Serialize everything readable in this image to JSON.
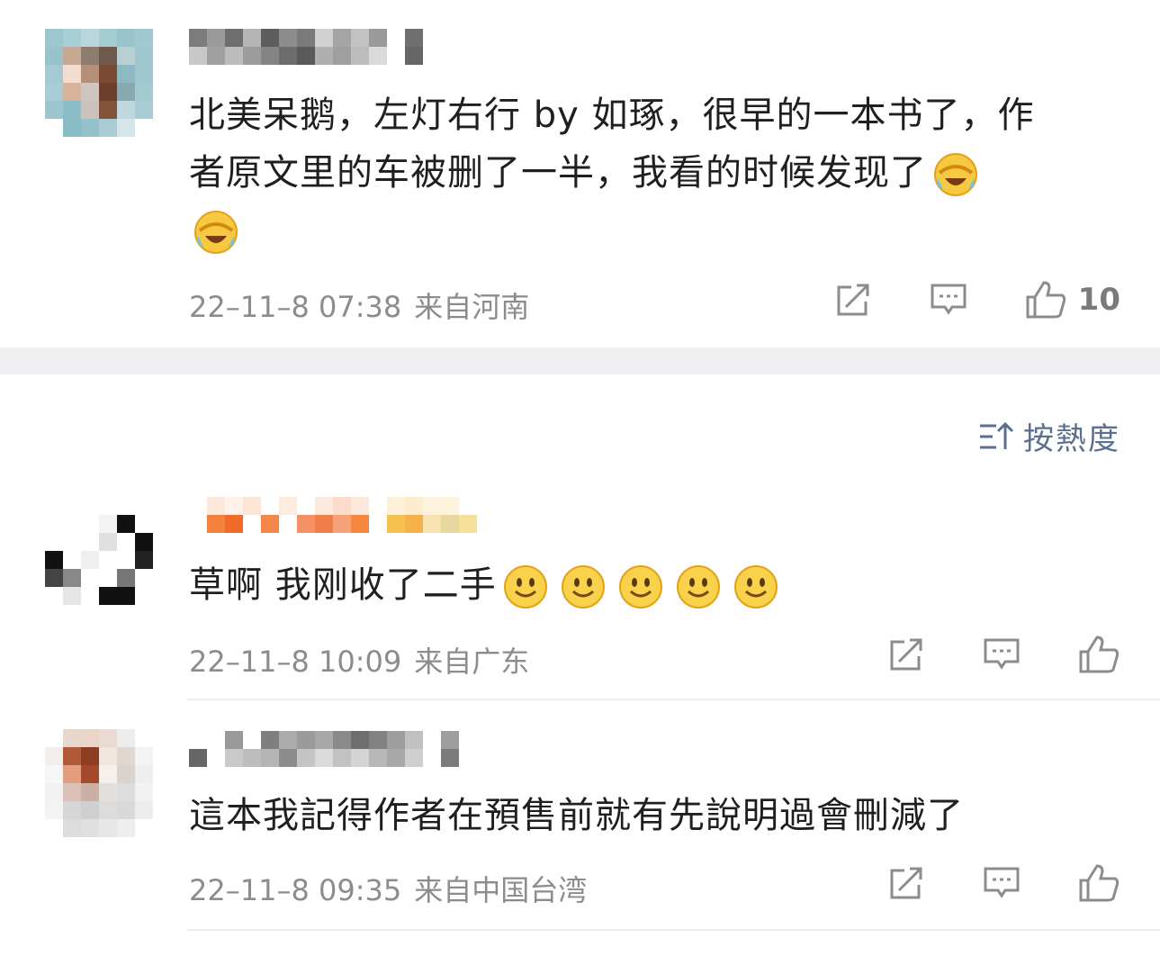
{
  "comments": [
    {
      "text_line1": "北美呆鹅，左灯右行 by 如琢，很早的一本书了，作",
      "text_line2": "者原文里的车被删了一半，我看的时候发现了",
      "time": "22–11–8 07:38",
      "region": "来自河南",
      "likes": "10",
      "emoji": "laughing-crying-emoji"
    },
    {
      "text": "草啊 我刚收了二手",
      "time": "22–11–8 10:09",
      "region": "来自广东",
      "emoji": "smile-emoji",
      "emoji_count": 5
    },
    {
      "text": "這本我記得作者在預售前就有先說明過會刪減了",
      "time": "22–11–8 09:35",
      "region": "来自中国台湾"
    }
  ],
  "sort": {
    "label": "按熱度",
    "icon": "sort-icon"
  },
  "colors": {
    "text": "#1f1f1f",
    "meta": "#8c8c8c",
    "accent": "#5b6f8f",
    "band": "#efeff1"
  }
}
